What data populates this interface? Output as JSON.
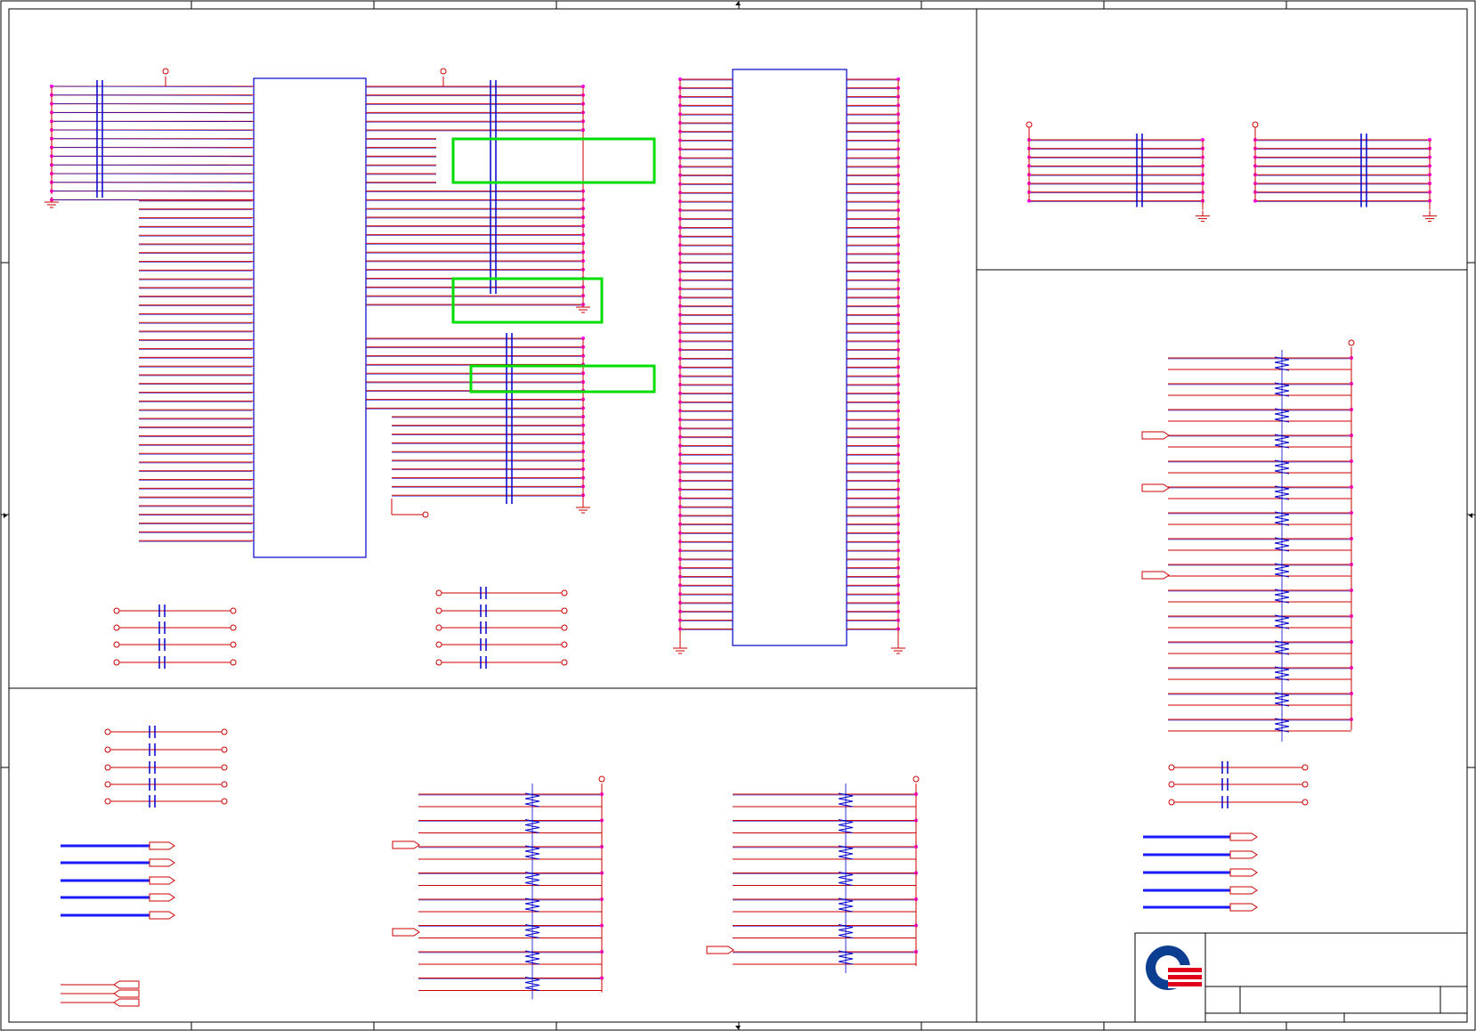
{
  "sheet": {
    "title_block": {
      "title": "",
      "logo_name": "company-logo"
    },
    "border_labels": {
      "top": [
        "",
        "",
        "",
        "",
        "",
        "",
        "",
        ""
      ],
      "side": [
        "",
        "",
        "",
        ""
      ]
    }
  },
  "colors": {
    "wire": "#cc0000",
    "bus": "#0000cc",
    "net_blue": "#1a1aff",
    "pin": "#ff00ff",
    "highlight": "#00dd00",
    "frame": "#000000",
    "logo_blue": "#0b3d91",
    "logo_red": "#e0001b"
  },
  "highlights": [
    {
      "name": "highlight-box-1"
    },
    {
      "name": "highlight-box-2"
    },
    {
      "name": "highlight-box-3"
    }
  ]
}
